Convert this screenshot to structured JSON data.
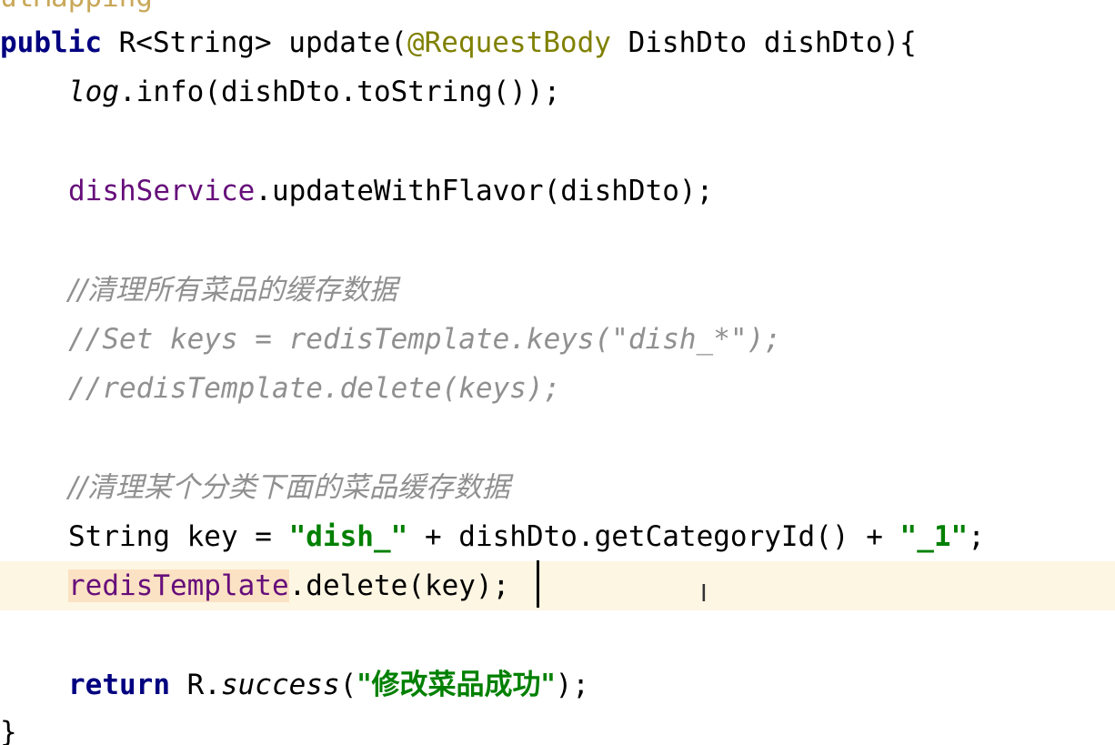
{
  "code": {
    "annotation_partial": "utMapping",
    "line_method": {
      "kw_public": "public",
      "type_ret": " R<String> update(",
      "annotation": "@RequestBody",
      "params": " DishDto dishDto){"
    },
    "line_log": {
      "log": "log",
      "rest": ".info(dishDto.toString());"
    },
    "line_service": {
      "field": "dishService",
      "rest": ".updateWithFlavor(dishDto);"
    },
    "comment_1": "//清理所有菜品的缓存数据",
    "comment_2": "//Set keys = redisTemplate.keys(\"dish_*\");",
    "comment_3": "//redisTemplate.delete(keys);",
    "comment_4": "//清理某个分类下面的菜品缓存数据",
    "line_key": {
      "decl": "String key = ",
      "str1": "\"dish_\"",
      "mid": " + dishDto.getCategoryId() + ",
      "str2": "\"_1\"",
      "end": ";"
    },
    "line_delete": {
      "field": "redisTemplate",
      "rest": ".delete(key);"
    },
    "line_return": {
      "kw_return": "return",
      "obj": " R.",
      "method": "success",
      "open": "(",
      "str": "\"修改菜品成功\"",
      "close": ");"
    },
    "closing_brace": "}"
  },
  "colors": {
    "keyword": "#000080",
    "field": "#660e7a",
    "string": "#008000",
    "comment": "#909090",
    "annotation": "#808000",
    "current_line": "#fdf6e3"
  },
  "cursor_icon": "i-beam-cursor"
}
